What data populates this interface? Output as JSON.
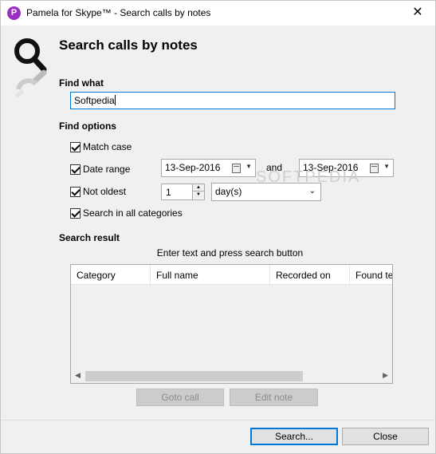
{
  "window": {
    "app_icon_letter": "P",
    "title": "Pamela for Skype™ - Search calls by notes",
    "close_glyph": "✕"
  },
  "header": {
    "title": "Search calls by notes",
    "icon": "magnifier-icon"
  },
  "find_what": {
    "label": "Find what",
    "value": "Softpedia"
  },
  "find_options": {
    "label": "Find options",
    "match_case": {
      "label": "Match case",
      "checked": true
    },
    "date_range": {
      "label": "Date range",
      "checked": true,
      "from": "13-Sep-2016",
      "and_label": "and",
      "to": "13-Sep-2016"
    },
    "not_oldest": {
      "label": "Not oldest",
      "checked": true,
      "value": "1",
      "unit": "day(s)"
    },
    "search_all": {
      "label": "Search in all categories",
      "checked": true
    }
  },
  "search_result": {
    "label": "Search result",
    "hint": "Enter text and press search button",
    "columns": [
      "Category",
      "Full name",
      "Recorded on",
      "Found te"
    ]
  },
  "actions": {
    "goto_call": "Goto call",
    "edit_note": "Edit note",
    "search": "Search...",
    "close": "Close"
  },
  "watermark": "SOFTPEDIA"
}
